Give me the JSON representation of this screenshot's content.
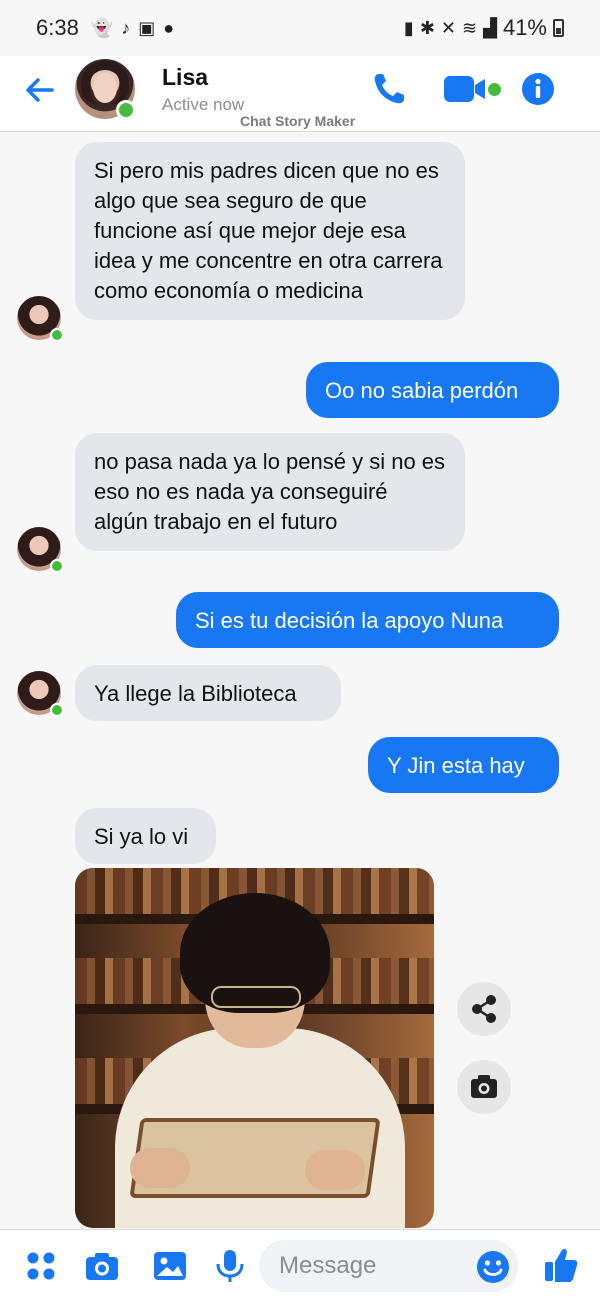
{
  "status": {
    "time": "6:38",
    "battery": "41%"
  },
  "header": {
    "name": "Lisa",
    "status": "Active now",
    "watermark": "Chat Story Maker"
  },
  "messages": [
    {
      "dir": "in",
      "text": "Si pero mis padres dicen que no es algo que sea seguro de que funcione así que mejor deje esa idea y me concentre en otra carrera como economía o medicina"
    },
    {
      "dir": "out",
      "text": "Oo no sabia perdón"
    },
    {
      "dir": "in",
      "text": "no pasa nada ya lo pensé y si no es eso no es nada ya conseguiré algún trabajo en el futuro"
    },
    {
      "dir": "out",
      "text": "Si es tu decisión la apoyo Nuna"
    },
    {
      "dir": "in",
      "text": "Ya llege la Biblioteca"
    },
    {
      "dir": "out",
      "text": "Y Jin esta hay"
    },
    {
      "dir": "in",
      "text": "Si ya lo vi"
    }
  ],
  "composer": {
    "placeholder": "Message"
  },
  "colors": {
    "accent": "#1877f2",
    "online": "#45bd3c",
    "bubble_in": "#e4e6eb"
  }
}
